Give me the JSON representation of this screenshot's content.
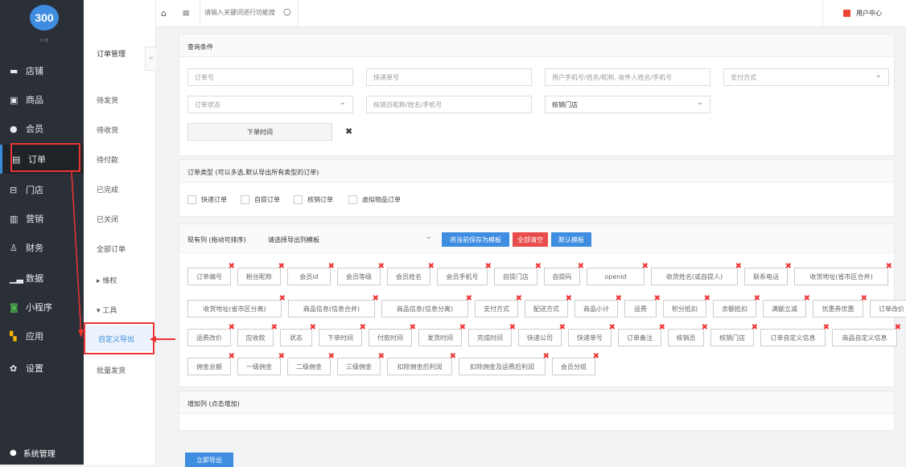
{
  "logo": {
    "text": "300"
  },
  "sidebar": {
    "collapse_label": "<≡",
    "items": [
      {
        "label": "店铺",
        "icon": "store-icon"
      },
      {
        "label": "商品",
        "icon": "product-icon"
      },
      {
        "label": "会员",
        "icon": "member-icon"
      },
      {
        "label": "订单",
        "icon": "order-icon"
      },
      {
        "label": "门店",
        "icon": "shop-icon"
      },
      {
        "label": "营销",
        "icon": "gift-icon"
      },
      {
        "label": "财务",
        "icon": "finance-icon"
      },
      {
        "label": "数据",
        "icon": "chart-icon"
      },
      {
        "label": "小程序",
        "icon": "miniprogram-icon"
      },
      {
        "label": "应用",
        "icon": "app-icon"
      },
      {
        "label": "设置",
        "icon": "gear-icon"
      }
    ],
    "system": "系统管理"
  },
  "submenu": {
    "title": "订单管理",
    "collapse": "<",
    "items": [
      "待发货",
      "待收货",
      "待付款",
      "已完成",
      "已关闭",
      "全部订单",
      "维权",
      "工具",
      "自定义导出",
      "批量发货"
    ]
  },
  "topbar": {
    "search_placeholder": "请输入关键词进行功能搜",
    "user": "用户中心"
  },
  "query": {
    "title": "查询条件",
    "fields": {
      "order_no": "订单号",
      "express_no": "快递单号",
      "user": "用户手机号/姓名/昵称, 收件人姓名/手机号",
      "payment": "支付方式",
      "status": "订单状态",
      "verifier": "核销员昵称/姓名/手机号",
      "store": "核销门店",
      "time": "下单时间",
      "clear": "✖"
    }
  },
  "order_type": {
    "title": "订单类型 (可以多选,默认导出所有类型的订单)",
    "options": [
      "快递订单",
      "自提订单",
      "核销订单",
      "虚拟物品订单"
    ]
  },
  "columns": {
    "label": "现有列 (拖动可排序)",
    "template_select": "请选择导出列模板",
    "btn_save": "将当前保存为模板",
    "btn_clear": "全部清空",
    "btn_default": "默认模板",
    "tags_row1": [
      "订单编号",
      "粉丝昵称",
      "会员id",
      "会员等级",
      "会员姓名",
      "会员手机号",
      "自提门店",
      "自提码",
      "openid",
      "收货姓名(或自提人)",
      "联系电话",
      "收货地址(省市区合并)"
    ],
    "tags_row2": [
      "收货地址(省市区分离)",
      "商品信息(信息合并)",
      "商品信息(信息分离)",
      "支付方式",
      "配送方式",
      "商品小计",
      "运费",
      "积分抵扣",
      "余额抵扣",
      "满额立减",
      "优惠券优惠",
      "订单改价"
    ],
    "tags_row3": [
      "运费改价",
      "应收款",
      "状态",
      "下单时间",
      "付款时间",
      "发货时间",
      "完成时间",
      "快递公司",
      "快递单号",
      "订单备注",
      "核销员",
      "核销门店",
      "订单自定义信息",
      "商品自定义信息"
    ],
    "tags_row4": [
      "佣金总额",
      "一级佣金",
      "二级佣金",
      "三级佣金",
      "扣除佣金后利润",
      "扣除佣金及运费后利润",
      "会员分组"
    ]
  },
  "add_columns": {
    "title": "增加列 (点击增加)"
  },
  "export_button": "立即导出",
  "colors": {
    "sidebar": "#2b3038",
    "accent": "#3f8de0",
    "danger": "#e84c4c",
    "highlight": "#e33333"
  }
}
